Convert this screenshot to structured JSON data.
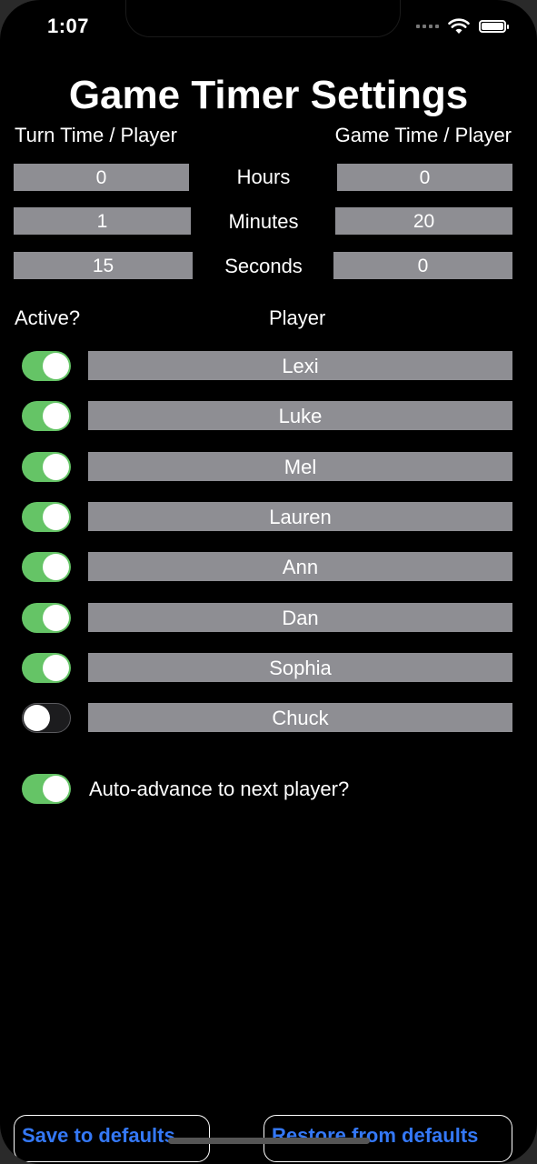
{
  "status_bar": {
    "time": "1:07",
    "icons": [
      "cellular-signal-icon",
      "wifi-icon",
      "battery-icon"
    ]
  },
  "title": "Game Timer Settings",
  "columns": {
    "turn": "Turn Time / Player",
    "game": "Game Time / Player"
  },
  "time_rows": [
    {
      "unit": "Hours",
      "turn_value": "0",
      "game_value": "0"
    },
    {
      "unit": "Minutes",
      "turn_value": "1",
      "game_value": "20"
    },
    {
      "unit": "Seconds",
      "turn_value": "15",
      "game_value": "0"
    }
  ],
  "players_header": {
    "active": "Active?",
    "player": "Player"
  },
  "players": [
    {
      "name": "Lexi",
      "active": true
    },
    {
      "name": "Luke",
      "active": true
    },
    {
      "name": "Mel",
      "active": true
    },
    {
      "name": "Lauren",
      "active": true
    },
    {
      "name": "Ann",
      "active": true
    },
    {
      "name": "Dan",
      "active": true
    },
    {
      "name": "Sophia",
      "active": true
    },
    {
      "name": "Chuck",
      "active": false
    }
  ],
  "auto_advance": {
    "label": "Auto-advance to next player?",
    "enabled": true
  },
  "buttons": {
    "save": "Save to defaults",
    "restore": "Restore from defaults"
  },
  "colors": {
    "background": "#000000",
    "field": "#8e8e93",
    "toggle_on": "#65c466",
    "accent": "#3478f6"
  }
}
